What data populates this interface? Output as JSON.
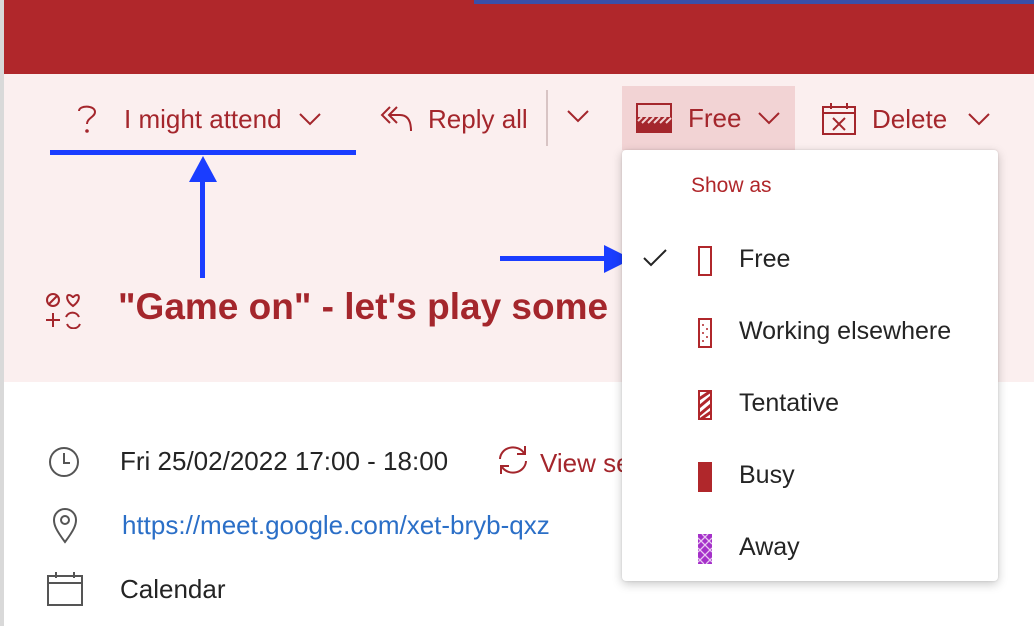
{
  "toolbar": {
    "rsvp_label": "I might attend",
    "reply_all_label": "Reply all",
    "show_as_label": "Free",
    "delete_label": "Delete"
  },
  "event": {
    "title": "\"Game on\" - let's play some",
    "time": "Fri 25/02/2022 17:00 - 18:00",
    "view_series_label": "View se",
    "location_url": "https://meet.google.com/xet-bryb-qxz",
    "calendar": "Calendar"
  },
  "show_as_menu": {
    "heading": "Show as",
    "selected": "Free",
    "items": [
      {
        "label": "Free",
        "icon": "free-status-icon",
        "checked": true
      },
      {
        "label": "Working elsewhere",
        "icon": "working-elsewhere-status-icon",
        "checked": false
      },
      {
        "label": "Tentative",
        "icon": "tentative-status-icon",
        "checked": false
      },
      {
        "label": "Busy",
        "icon": "busy-status-icon",
        "checked": false
      },
      {
        "label": "Away",
        "icon": "away-status-icon",
        "checked": false
      }
    ]
  },
  "colors": {
    "brand": "#b0272b",
    "accent_text": "#a4262c",
    "header_bg": "#fbefef",
    "annotation": "#1a3dff",
    "link": "#2b6fc7",
    "away": "#a530c9"
  }
}
